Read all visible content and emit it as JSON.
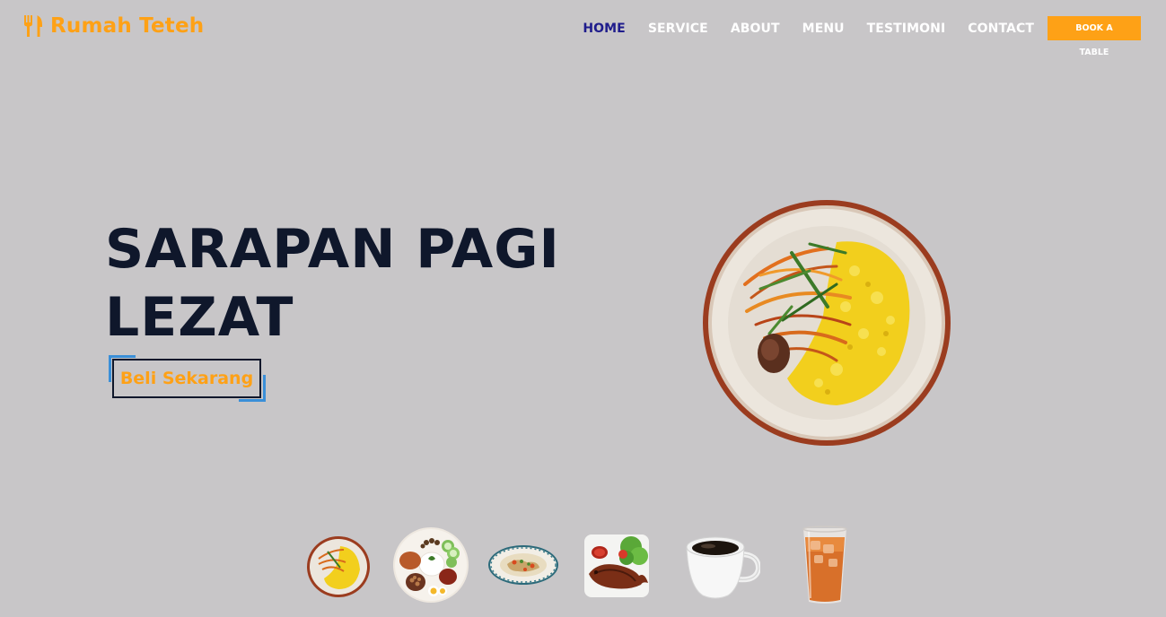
{
  "brand": {
    "name": "Rumah Teteh",
    "icon": "utensils-icon",
    "color": "#fea116"
  },
  "nav": {
    "items": [
      {
        "label": "HOME",
        "active": true
      },
      {
        "label": "SERVICE",
        "active": false
      },
      {
        "label": "ABOUT",
        "active": false
      },
      {
        "label": "MENU",
        "active": false
      },
      {
        "label": "TESTIMONI",
        "active": false
      },
      {
        "label": "CONTACT",
        "active": false
      }
    ],
    "book_label": "BOOK A TABLE"
  },
  "hero": {
    "title_line1": "SARAPAN PAGI",
    "title_line2": "LEZAT",
    "cta_label": "Beli Sekarang",
    "image": "nasi-kuning-plate"
  },
  "thumbnails": [
    {
      "name": "nasi-kuning-thumb"
    },
    {
      "name": "nasi-lemak-thumb"
    },
    {
      "name": "soup-bowl-thumb"
    },
    {
      "name": "grilled-fish-thumb"
    },
    {
      "name": "coffee-cup-thumb"
    },
    {
      "name": "iced-tea-thumb"
    }
  ],
  "colors": {
    "background": "#c8c6c8",
    "accent": "#fea116",
    "heading": "#0f172b",
    "nav_active": "#1f1c8c",
    "cta_corner": "#3a8fd8"
  }
}
